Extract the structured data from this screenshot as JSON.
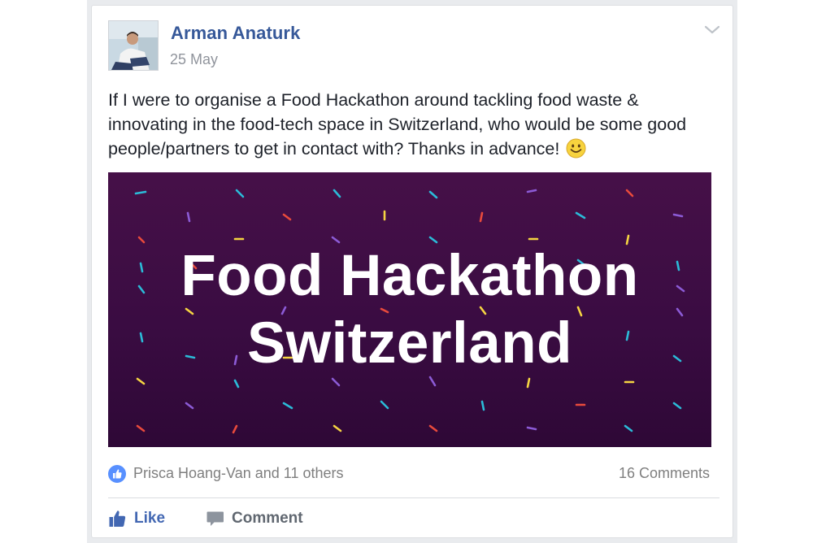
{
  "post": {
    "author": "Arman Anaturk",
    "date": "25 May",
    "text": "If I were to organise a Food Hackathon around tackling food waste & innovating in the food-tech space in Switzerland, who would be some good people/partners to get in contact with? Thanks in advance!",
    "emoji": "smiley-emoji"
  },
  "banner": {
    "title_line1": "Food Hackathon",
    "title_line2": "Switzerland",
    "background": "#3a0c42",
    "confetti_colors": [
      "#2bbbd8",
      "#8c5bd6",
      "#e84a3c",
      "#f5d442"
    ]
  },
  "reactions": {
    "likers": "Prisca Hoang-Van and 11 others",
    "comments": "16 Comments"
  },
  "actions": {
    "like_label": "Like",
    "comment_label": "Comment"
  },
  "colors": {
    "link": "#365899",
    "like_blue": "#4267b2",
    "muted": "#90949c"
  },
  "icons": {
    "menu": "chevron-down-icon",
    "like_badge": "thumbs-up-icon",
    "like": "thumbs-up-icon",
    "comment": "speech-bubble-icon"
  }
}
